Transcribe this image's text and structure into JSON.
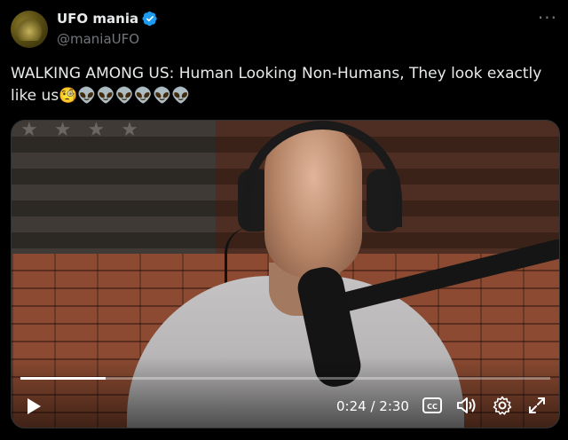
{
  "author": {
    "name": "UFO mania",
    "handle": "@maniaUFO",
    "verified": true
  },
  "more_menu": "···",
  "tweet": {
    "text": "WALKING AMONG US: Human Looking Non-Humans, They look exactly like us",
    "emojis": "🧐👽👽👽👽👽👽"
  },
  "video": {
    "current_time": "0:24",
    "duration": "2:30",
    "time_display": "0:24 / 2:30",
    "progress": 0.16
  },
  "colors": {
    "background": "#000000",
    "text": "#e7e9ea",
    "secondary_text": "#71767b",
    "verified_badge": "#1d9bf0"
  }
}
